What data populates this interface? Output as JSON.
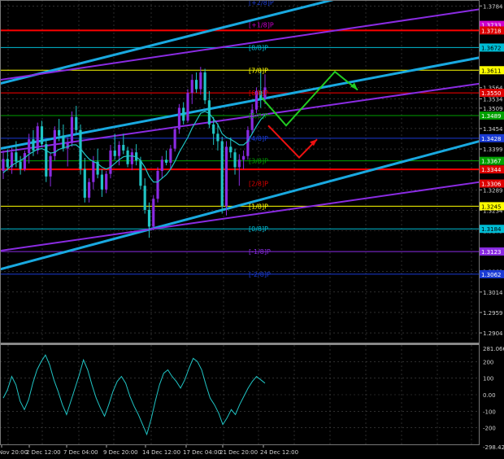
{
  "chart_data": {
    "type": "candlestick",
    "instrument_note": "",
    "main": {
      "ylim": [
        1.288,
        1.38
      ],
      "price_ticks": [
        "1.3784",
        "1.3564",
        "1.3534",
        "1.3509",
        "1.3454",
        "1.3399",
        "1.3289",
        "1.3234",
        "1.3179",
        "1.3069",
        "1.3014",
        "1.2959",
        "1.2904"
      ],
      "highlight_labels": [
        {
          "price": 1.3733,
          "text": "1.3733",
          "color": "#cc00cc"
        },
        {
          "price": 1.3718,
          "text": "1.3718",
          "color": "#dd0000"
        },
        {
          "price": 1.3672,
          "text": "1.3672",
          "color": "#00bcd4"
        },
        {
          "price": 1.3611,
          "text": "1.3611",
          "color": "#ffff00"
        },
        {
          "price": 1.355,
          "text": "1.3550",
          "color": "#dd0000"
        },
        {
          "price": 1.3489,
          "text": "1.3489",
          "color": "#00a000"
        },
        {
          "price": 1.3428,
          "text": "1.3428",
          "color": "#1a3bd4"
        },
        {
          "price": 1.3367,
          "text": "1.3367",
          "color": "#00a000"
        },
        {
          "price": 1.3344,
          "text": "1.3344",
          "color": "#dd0000"
        },
        {
          "price": 1.3306,
          "text": "1.3306",
          "color": "#dd0000"
        },
        {
          "price": 1.3245,
          "text": "1.3245",
          "color": "#ffff00"
        },
        {
          "price": 1.3184,
          "text": "1.3184",
          "color": "#00bcd4"
        },
        {
          "price": 1.3123,
          "text": "1.3123",
          "color": "#8a2be2"
        },
        {
          "price": 1.3062,
          "text": "1.3062",
          "color": "#1a3bd4"
        }
      ],
      "murrey_levels": [
        {
          "label": "[+2/8]P",
          "price": 1.3794,
          "color": "#1a3bd4"
        },
        {
          "label": "[+1/8]P",
          "price": 1.3733,
          "color": "#cc00cc"
        },
        {
          "label": "[8/8]P",
          "price": 1.3672,
          "color": "#00bcd4"
        },
        {
          "label": "[7/8]P",
          "price": 1.3611,
          "color": "#ffff00"
        },
        {
          "label": "[6/8]P",
          "price": 1.355,
          "color": "#dd0000"
        },
        {
          "label": "[5/8]P",
          "price": 1.3489,
          "color": "#00a000"
        },
        {
          "label": "[4/8]P",
          "price": 1.3428,
          "color": "#1a3bd4"
        },
        {
          "label": "[3/8]P",
          "price": 1.3367,
          "color": "#00a000"
        },
        {
          "label": "[2/8]P",
          "price": 1.3306,
          "color": "#dd0000"
        },
        {
          "label": "[1/8]P",
          "price": 1.3245,
          "color": "#ffff00"
        },
        {
          "label": "[0/8]P",
          "price": 1.3184,
          "color": "#00bcd4"
        },
        {
          "label": "[-1/8]P",
          "price": 1.3123,
          "color": "#8a2be2"
        },
        {
          "label": "[-2/8]P",
          "price": 1.3062,
          "color": "#1a3bd4"
        }
      ],
      "horizontal_lines": [
        {
          "price": 1.3718,
          "color": "#ff0000",
          "width": 2
        },
        {
          "price": 1.3672,
          "color": "#00bcd4",
          "width": 1
        },
        {
          "price": 1.3611,
          "color": "#ffff00",
          "width": 1
        },
        {
          "price": 1.355,
          "color": "#ff0000",
          "width": 1
        },
        {
          "price": 1.3489,
          "color": "#00a000",
          "width": 1
        },
        {
          "price": 1.3428,
          "color": "#1a3bd4",
          "width": 1
        },
        {
          "price": 1.3367,
          "color": "#00a000",
          "width": 1
        },
        {
          "price": 1.3344,
          "color": "#ff0000",
          "width": 2
        },
        {
          "price": 1.3245,
          "color": "#ffff00",
          "width": 1
        },
        {
          "price": 1.3184,
          "color": "#00bcd4",
          "width": 1
        },
        {
          "price": 1.3123,
          "color": "#8a2be2",
          "width": 1
        },
        {
          "price": 1.3062,
          "color": "#1a3bd4",
          "width": 1
        }
      ],
      "channels": [
        {
          "color": "#19a9e0",
          "width": 3,
          "from": [
            0,
            1.3575
          ],
          "to": [
            1,
            1.39
          ]
        },
        {
          "color": "#19a9e0",
          "width": 3,
          "from": [
            0,
            1.34
          ],
          "to": [
            1,
            1.3645
          ]
        },
        {
          "color": "#19a9e0",
          "width": 3,
          "from": [
            0,
            1.3075
          ],
          "to": [
            1,
            1.342
          ]
        },
        {
          "color": "#8a2be2",
          "width": 2,
          "from": [
            0,
            1.3585
          ],
          "to": [
            1,
            1.3775
          ]
        },
        {
          "color": "#8a2be2",
          "width": 2,
          "from": [
            0,
            1.339
          ],
          "to": [
            1,
            1.3575
          ]
        },
        {
          "color": "#8a2be2",
          "width": 2,
          "from": [
            0,
            1.3125
          ],
          "to": [
            1,
            1.331
          ]
        }
      ],
      "forecast_green": [
        [
          322,
          1.3537
        ],
        [
          352,
          1.3462
        ],
        [
          412,
          1.3607
        ],
        [
          440,
          1.3558
        ]
      ],
      "forecast_red": [
        [
          330,
          1.3462
        ],
        [
          368,
          1.3376
        ],
        [
          390,
          1.3425
        ]
      ],
      "candles_ohlc": [
        [
          1.334,
          1.3395,
          1.3318,
          1.3372
        ],
        [
          1.3372,
          1.3398,
          1.3341,
          1.335
        ],
        [
          1.335,
          1.3402,
          1.3332,
          1.339
        ],
        [
          1.339,
          1.342,
          1.335,
          1.3365
        ],
        [
          1.3365,
          1.338,
          1.333,
          1.3345
        ],
        [
          1.3345,
          1.3395,
          1.3339,
          1.3388
        ],
        [
          1.3388,
          1.344,
          1.336,
          1.3425
        ],
        [
          1.3425,
          1.345,
          1.338,
          1.3395
        ],
        [
          1.3395,
          1.347,
          1.3385,
          1.346
        ],
        [
          1.346,
          1.3475,
          1.3405,
          1.3412
        ],
        [
          1.3412,
          1.3425,
          1.331,
          1.3325
        ],
        [
          1.3325,
          1.339,
          1.3298,
          1.338
        ],
        [
          1.338,
          1.346,
          1.3368,
          1.345
        ],
        [
          1.345,
          1.348,
          1.342,
          1.3435
        ],
        [
          1.3435,
          1.3465,
          1.3392,
          1.34
        ],
        [
          1.34,
          1.343,
          1.3352,
          1.3415
        ],
        [
          1.3415,
          1.35,
          1.3405,
          1.3485
        ],
        [
          1.3485,
          1.3515,
          1.344,
          1.345
        ],
        [
          1.345,
          1.3465,
          1.333,
          1.3345
        ],
        [
          1.3345,
          1.3375,
          1.3255,
          1.3268
        ],
        [
          1.3268,
          1.332,
          1.3255,
          1.331
        ],
        [
          1.331,
          1.338,
          1.329,
          1.3365
        ],
        [
          1.3365,
          1.34,
          1.332,
          1.333
        ],
        [
          1.333,
          1.3345,
          1.327,
          1.329
        ],
        [
          1.329,
          1.334,
          1.328,
          1.3332
        ],
        [
          1.3332,
          1.341,
          1.332,
          1.3395
        ],
        [
          1.3395,
          1.344,
          1.337,
          1.338
        ],
        [
          1.338,
          1.342,
          1.3355,
          1.341
        ],
        [
          1.341,
          1.344,
          1.3385,
          1.3395
        ],
        [
          1.3395,
          1.3405,
          1.335,
          1.3358
        ],
        [
          1.3358,
          1.34,
          1.3342,
          1.339
        ],
        [
          1.339,
          1.3412,
          1.3355,
          1.3368
        ],
        [
          1.3368,
          1.3378,
          1.329,
          1.33
        ],
        [
          1.33,
          1.332,
          1.3225,
          1.3235
        ],
        [
          1.3235,
          1.3255,
          1.316,
          1.319
        ],
        [
          1.319,
          1.3275,
          1.318,
          1.3265
        ],
        [
          1.3265,
          1.335,
          1.3255,
          1.334
        ],
        [
          1.334,
          1.338,
          1.332,
          1.337
        ],
        [
          1.337,
          1.3395,
          1.3355,
          1.3362
        ],
        [
          1.3362,
          1.341,
          1.3345,
          1.34
        ],
        [
          1.34,
          1.346,
          1.3392,
          1.3452
        ],
        [
          1.3452,
          1.352,
          1.344,
          1.351
        ],
        [
          1.351,
          1.3525,
          1.3465,
          1.3475
        ],
        [
          1.3475,
          1.356,
          1.347,
          1.355
        ],
        [
          1.355,
          1.36,
          1.352,
          1.3585
        ],
        [
          1.3585,
          1.3605,
          1.355,
          1.356
        ],
        [
          1.356,
          1.362,
          1.3545,
          1.3605
        ],
        [
          1.3605,
          1.3615,
          1.352,
          1.353
        ],
        [
          1.353,
          1.3555,
          1.3455,
          1.3465
        ],
        [
          1.3465,
          1.3485,
          1.341,
          1.344
        ],
        [
          1.344,
          1.3468,
          1.3395,
          1.342
        ],
        [
          1.342,
          1.3432,
          1.3225,
          1.3245
        ],
        [
          1.3245,
          1.342,
          1.322,
          1.3405
        ],
        [
          1.3405,
          1.343,
          1.3375,
          1.339
        ],
        [
          1.339,
          1.34,
          1.333,
          1.335
        ],
        [
          1.335,
          1.3385,
          1.33,
          1.337
        ],
        [
          1.337,
          1.3395,
          1.3345,
          1.338
        ],
        [
          1.338,
          1.346,
          1.337,
          1.345
        ],
        [
          1.345,
          1.352,
          1.344,
          1.3505
        ],
        [
          1.3505,
          1.3565,
          1.3495,
          1.3555
        ],
        [
          1.3555,
          1.361,
          1.351,
          1.3535
        ],
        [
          1.3535,
          1.36,
          1.352,
          1.3565
        ]
      ],
      "ma_values": [
        1.3335,
        1.3345,
        1.3355,
        1.3362,
        1.3368,
        1.3375,
        1.3385,
        1.3392,
        1.3398,
        1.34,
        1.3395,
        1.3388,
        1.339,
        1.3398,
        1.3402,
        1.3405,
        1.341,
        1.341,
        1.34,
        1.3385,
        1.3372,
        1.3365,
        1.336,
        1.335,
        1.3345,
        1.335,
        1.336,
        1.337,
        1.3378,
        1.338,
        1.338,
        1.3378,
        1.3368,
        1.335,
        1.3325,
        1.331,
        1.331,
        1.332,
        1.333,
        1.3345,
        1.3365,
        1.339,
        1.341,
        1.343,
        1.3455,
        1.3475,
        1.3495,
        1.35,
        1.3495,
        1.348,
        1.3465,
        1.344,
        1.343,
        1.3425,
        1.3418,
        1.341,
        1.341,
        1.342,
        1.344,
        1.346,
        1.3478,
        1.349
      ],
      "time_labels": [
        "Nov 20:00",
        "2 Dec 12:00",
        "7 Dec 04:00",
        "9 Dec 20:00",
        "14 Dec 12:00",
        "17 Dec 04:00",
        "21 Dec 20:00",
        "24 Dec 12:00"
      ]
    },
    "cci": {
      "ylim": [
        -300,
        300
      ],
      "ticks": [
        "200",
        "100",
        "0.00",
        "-100",
        "-200"
      ],
      "top_label": "281.0664",
      "bottom_label": "-298.4270",
      "values": [
        -20,
        30,
        110,
        60,
        -40,
        -90,
        -30,
        70,
        150,
        200,
        240,
        180,
        90,
        20,
        -60,
        -120,
        -40,
        40,
        120,
        210,
        150,
        60,
        -20,
        -80,
        -130,
        -60,
        20,
        80,
        110,
        70,
        -10,
        -70,
        -120,
        -180,
        -240,
        -150,
        -40,
        60,
        130,
        150,
        110,
        80,
        40,
        90,
        160,
        220,
        200,
        150,
        60,
        -20,
        -60,
        -110,
        -180,
        -140,
        -90,
        -120,
        -60,
        -10,
        40,
        80,
        110,
        90,
        70
      ]
    },
    "colors": {
      "background": "#000000",
      "grid": "#4a4a4a",
      "bull": "#8a2be2",
      "bear": "#20c4c4",
      "ma": "#20c4c4",
      "cci": "#20c4c4",
      "axis_text": "#d0d0d0"
    }
  }
}
